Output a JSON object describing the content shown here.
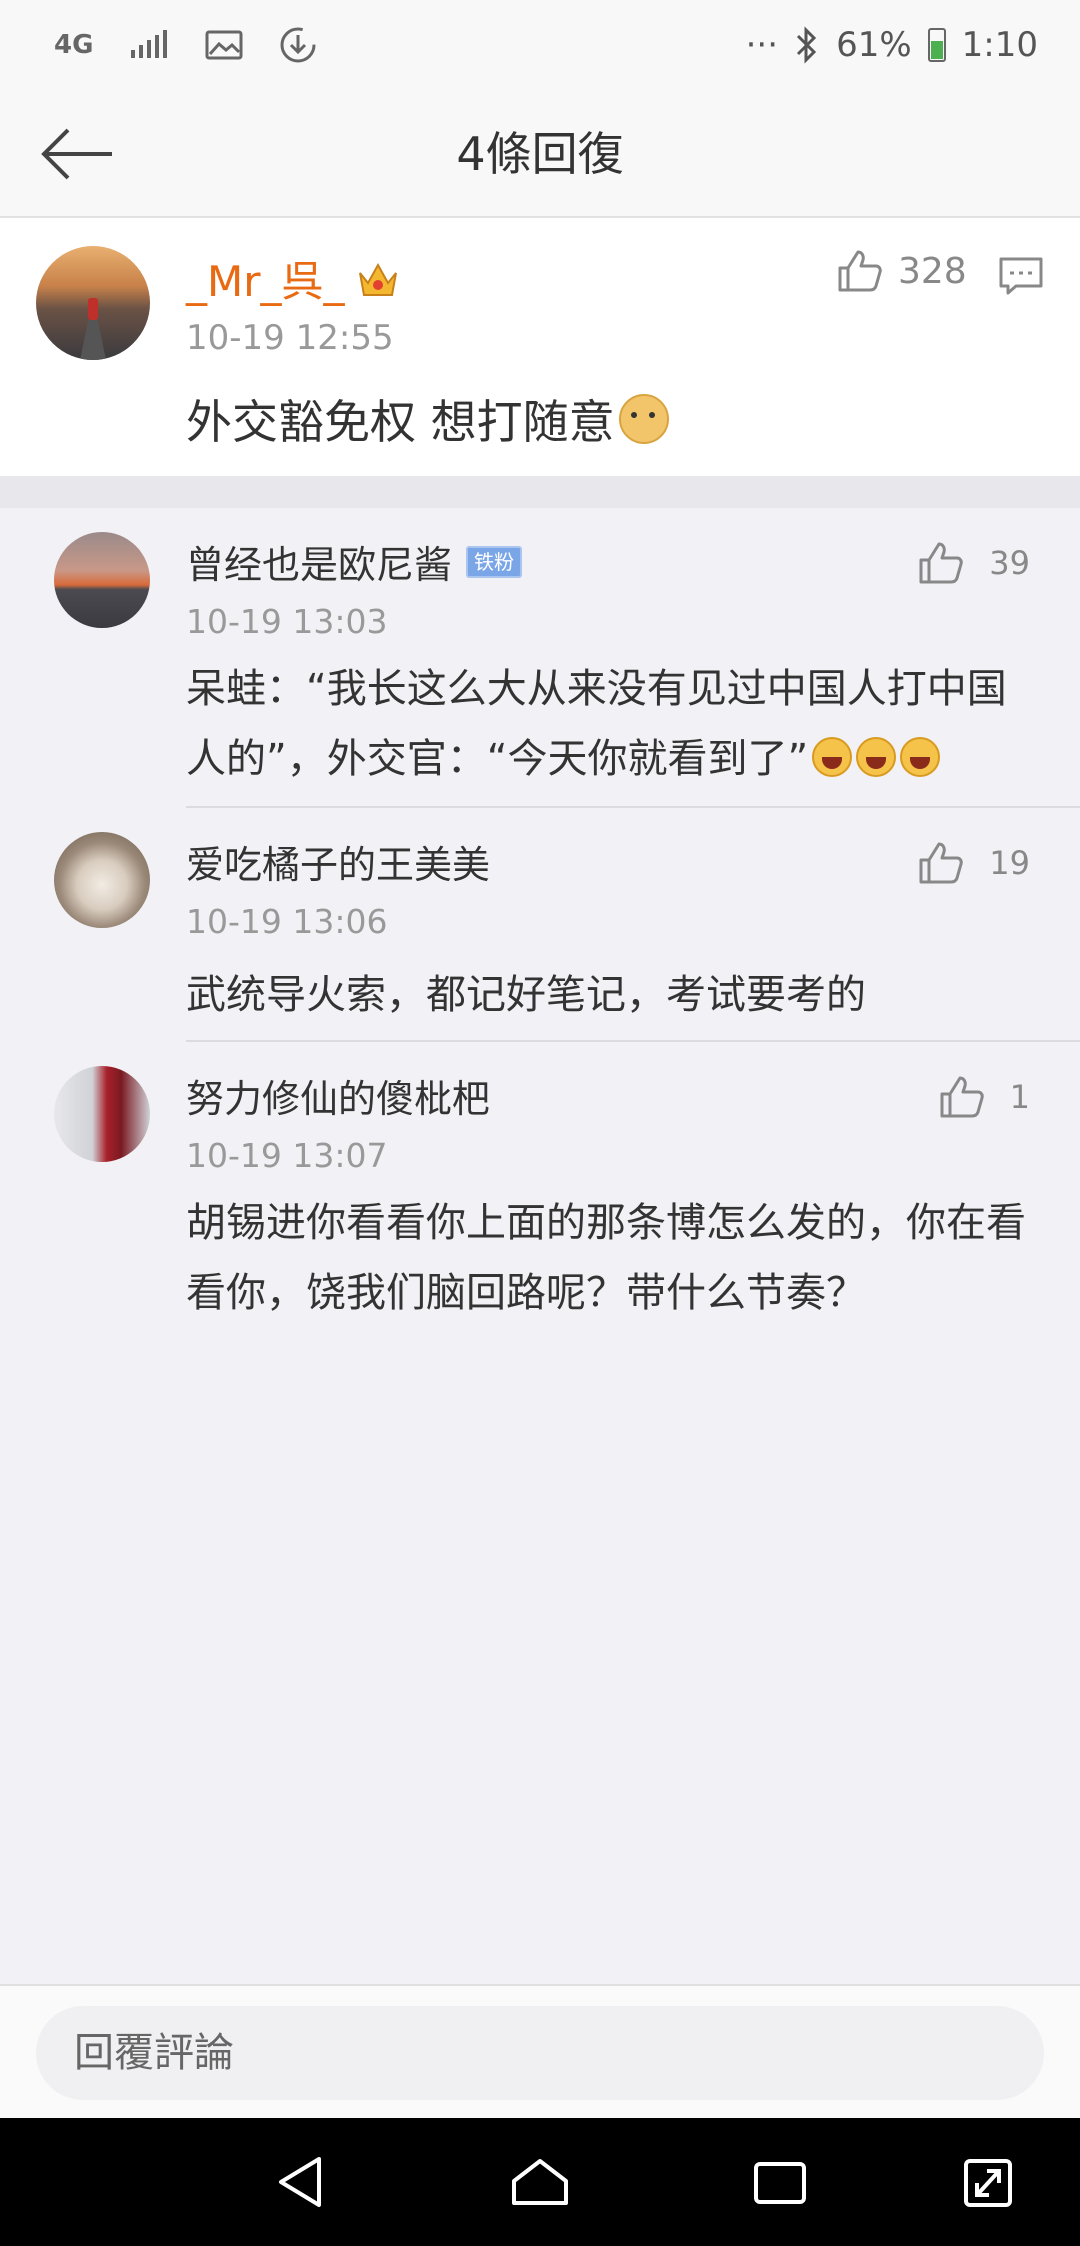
{
  "status_bar": {
    "network": "4G",
    "battery": "61%",
    "time": "1:10",
    "more": "···"
  },
  "header": {
    "title": "4條回復"
  },
  "main_comment": {
    "name": "_Mr_呉_",
    "time": "10-19 12:55",
    "text": "外交豁免权 想打随意",
    "likes": "328"
  },
  "replies": [
    {
      "name": "曾经也是欧尼酱",
      "badge": "铁粉",
      "time": "10-19 13:03",
      "text": "呆蛙：“我长这么大从来没有见过中国人打中国人的”，外交官：“今天你就看到了”",
      "likes": "39"
    },
    {
      "name": "爱吃橘子的王美美",
      "time": "10-19 13:06",
      "text": "武统导火索，都记好笔记，考试要考的",
      "likes": "19"
    },
    {
      "name": "努力修仙的傻枇杷",
      "time": "10-19 13:07",
      "text": "胡锡进你看看你上面的那条博怎么发的，你在看看你，饶我们脑回路呢？带什么节奏？",
      "likes": "1"
    }
  ],
  "reply_input": {
    "placeholder": "回覆評論"
  },
  "colors": {
    "accent_name": "#e86a12",
    "meta": "#999999",
    "badge": "#7aa6e8"
  },
  "icons": [
    "network-4g-icon",
    "signal-icon",
    "image-icon",
    "download-icon",
    "bluetooth-icon",
    "battery-icon",
    "back-arrow-icon",
    "crown-icon",
    "doge-emoji-icon",
    "like-icon",
    "reply-comment-icon",
    "laugh-emoji-icon",
    "nav-back-icon",
    "nav-home-icon",
    "nav-recent-icon",
    "nav-expand-icon"
  ]
}
